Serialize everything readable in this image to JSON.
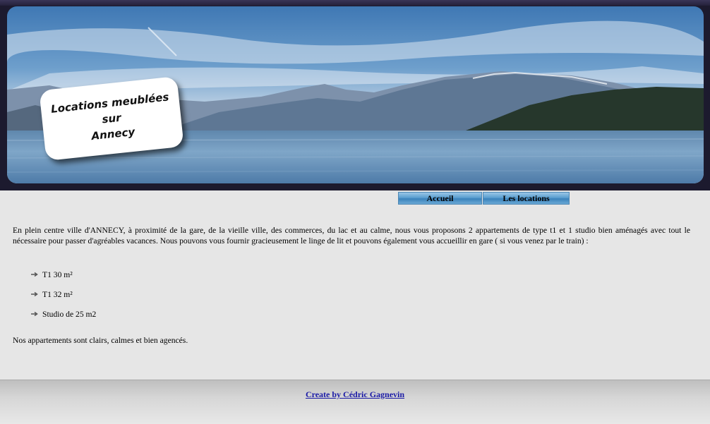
{
  "header": {
    "sign_lines": [
      "Locations meublées",
      "sur",
      "Annecy"
    ]
  },
  "nav": {
    "items": [
      {
        "label": "Accueil"
      },
      {
        "label": "Les locations"
      }
    ]
  },
  "main": {
    "intro": "En plein centre ville d'ANNECY, à proximité de la gare, de la vieille ville, des commerces, du lac et au calme, nous vous proposons 2 appartements de type t1 et 1 studio bien aménagés avec tout le nécessaire pour passer d'agréables vacances. Nous pouvons vous fournir gracieusement le linge de lit et pouvons également vous accueillir en gare ( si vous venez par le train) :",
    "list": [
      {
        "label": "T1 30 m²"
      },
      {
        "label": "T1 32 m²"
      },
      {
        "label": "Studio de 25 m2"
      }
    ],
    "closing": "Nos appartements sont clairs, calmes et bien agencés."
  },
  "footer": {
    "credit": "Create by Cédric Gagnevin"
  },
  "colors": {
    "background": "#e6e6e6",
    "nav_blue": "#4d87b4",
    "link": "#1a1aa6"
  }
}
